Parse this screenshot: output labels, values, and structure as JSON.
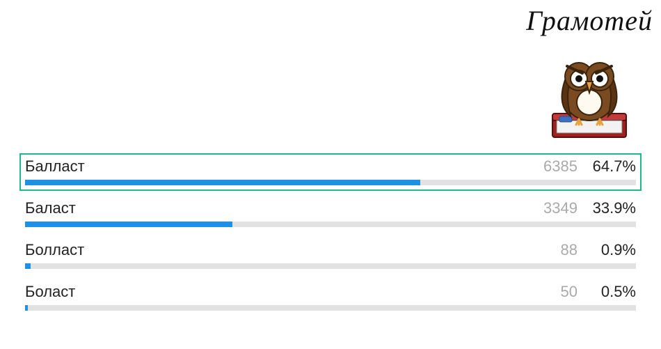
{
  "brand": {
    "title": "Грамотей"
  },
  "chart_data": {
    "type": "bar",
    "title": "",
    "categories": [
      "Балласт",
      "Баласт",
      "Болласт",
      "Боласт"
    ],
    "series": [
      {
        "name": "votes",
        "values": [
          6385,
          3349,
          88,
          50
        ]
      },
      {
        "name": "percent",
        "values": [
          64.7,
          33.9,
          0.9,
          0.5
        ]
      }
    ],
    "correct_index": 0,
    "xlabel": "",
    "ylabel": "",
    "ylim": [
      0,
      100
    ]
  },
  "rows": [
    {
      "label": "Балласт",
      "count": "6385",
      "pct": "64.7%",
      "width": 64.7,
      "correct": true
    },
    {
      "label": "Баласт",
      "count": "3349",
      "pct": "33.9%",
      "width": 33.9,
      "correct": false
    },
    {
      "label": "Болласт",
      "count": "88",
      "pct": "0.9%",
      "width": 0.9,
      "correct": false
    },
    {
      "label": "Боласт",
      "count": "50",
      "pct": "0.5%",
      "width": 0.5,
      "correct": false
    }
  ]
}
